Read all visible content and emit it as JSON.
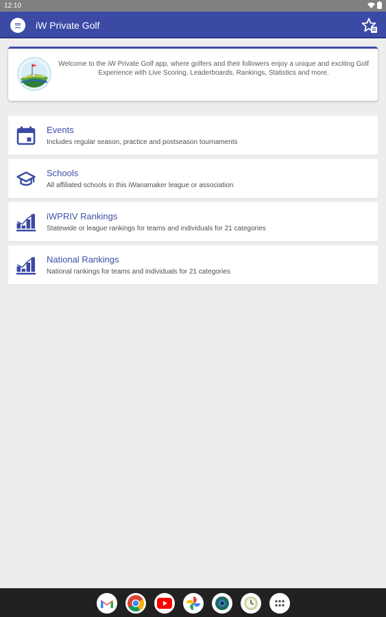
{
  "status_bar": {
    "time": "12:10"
  },
  "app_bar": {
    "title": "iW Private Golf"
  },
  "welcome": {
    "text": "Welcome to the iW Private Golf app, where golfers and their followers enjoy a unique and exciting Golf Experience with Live Scoring, Leaderboards, Rankings, Statistics and more."
  },
  "menu": {
    "items": [
      {
        "title": "Events",
        "description": "Includes regular season, practice and postseason tournaments",
        "icon": "calendar-icon"
      },
      {
        "title": "Schools",
        "description": "All affiliated schools in this iWanamaker league or association",
        "icon": "graduation-cap-icon"
      },
      {
        "title": "iWPRIV Rankings",
        "description": "Statewide or league rankings for teams and individuals for 21 categories",
        "icon": "bar-chart-icon"
      },
      {
        "title": "National Rankings",
        "description": "National rankings for teams and individuals for 21 categories",
        "icon": "bar-chart-icon"
      }
    ]
  },
  "dock": {
    "apps": [
      "gmail-icon",
      "chrome-icon",
      "youtube-icon",
      "photos-icon",
      "camera-icon",
      "clock-icon",
      "app-drawer-icon"
    ]
  },
  "colors": {
    "primary": "#3b4aa5",
    "link": "#3f4ea6",
    "background": "#ededed"
  }
}
